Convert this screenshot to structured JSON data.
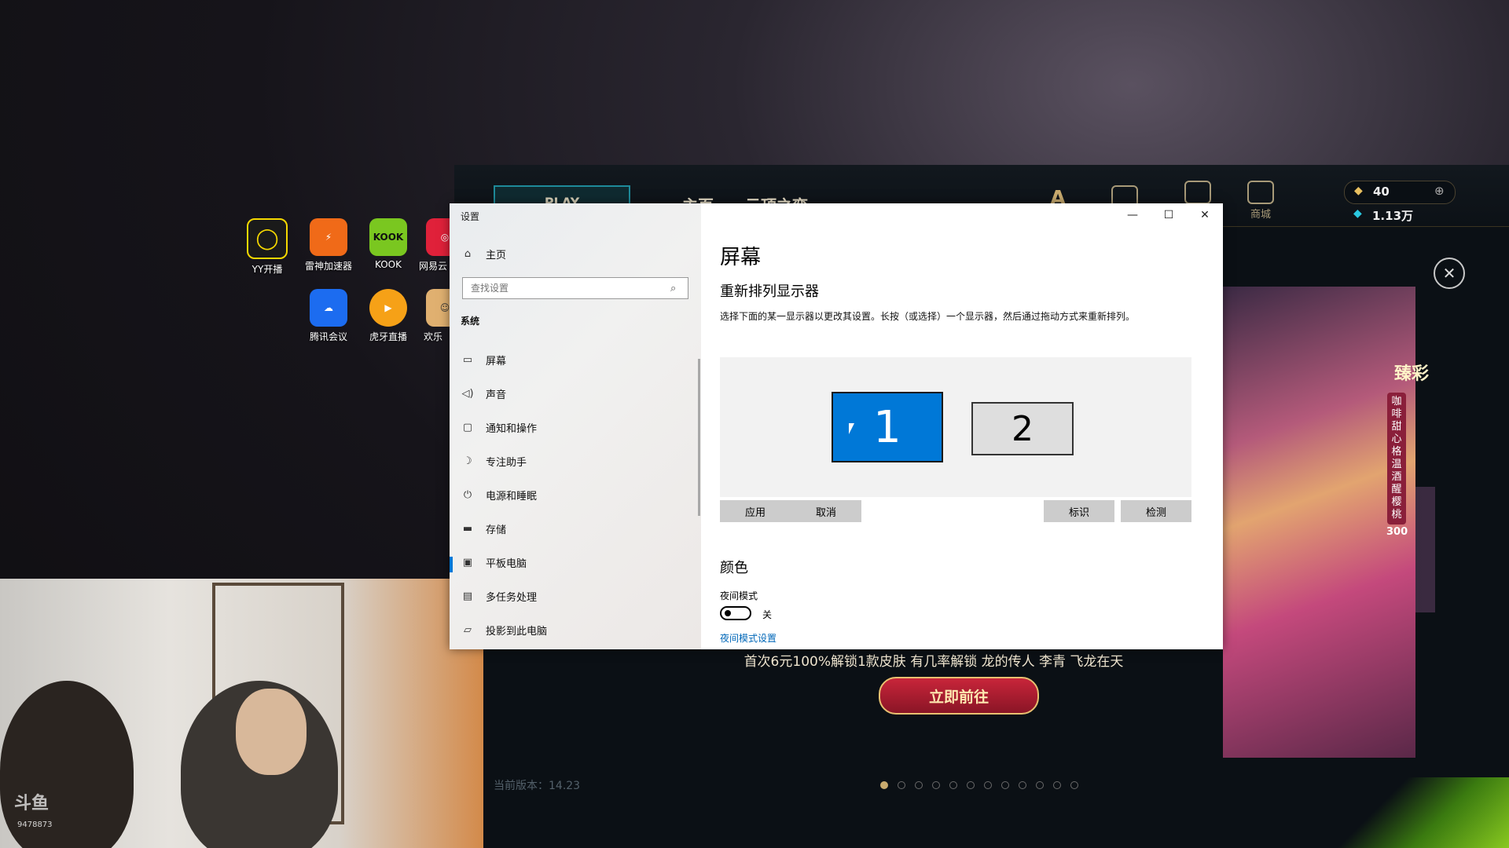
{
  "desktop": {
    "icons": [
      {
        "label": "YY开播",
        "icon": "yy-icon",
        "color": "#1a1a1a"
      },
      {
        "label": "雷神加速器",
        "icon": "leishen-icon",
        "color": "#f06a18"
      },
      {
        "label": "KOOK",
        "icon": "kook-icon",
        "color": "#7ac720"
      },
      {
        "label": "网易云",
        "icon": "netease-icon",
        "color": "#e0213a"
      },
      {
        "label": "腾讯会议",
        "icon": "tencent-meeting-icon",
        "color": "#1c6cf0"
      },
      {
        "label": "虎牙直播",
        "icon": "huya-icon",
        "color": "#f6a117"
      },
      {
        "label": "欢乐",
        "icon": "huanle-icon",
        "color": "#e0b070"
      }
    ]
  },
  "game": {
    "play": "PLAY",
    "nav": [
      "主页",
      "云顶之弈"
    ],
    "buttons": [
      "品",
      "商城"
    ],
    "currency_rp": "40",
    "currency_be": "1.13万",
    "promo_text": "首次6元100%解锁1款皮肤 有几率解锁 龙的传人 李青 飞龙在天",
    "promo_button": "立即前往",
    "version": "当前版本：14.23",
    "splash_title": "臻彩",
    "splash_vertical": "咖啡甜心格温 酒醒樱桃",
    "splash_price": "300"
  },
  "settings": {
    "title": "设置",
    "home": "主页",
    "search_placeholder": "查找设置",
    "section": "系统",
    "nav_items": [
      {
        "label": "屏幕",
        "icon": "display-icon"
      },
      {
        "label": "声音",
        "icon": "sound-icon"
      },
      {
        "label": "通知和操作",
        "icon": "notification-icon"
      },
      {
        "label": "专注助手",
        "icon": "focus-icon"
      },
      {
        "label": "电源和睡眠",
        "icon": "power-icon"
      },
      {
        "label": "存储",
        "icon": "storage-icon"
      },
      {
        "label": "平板电脑",
        "icon": "tablet-icon"
      },
      {
        "label": "多任务处理",
        "icon": "multitask-icon"
      },
      {
        "label": "投影到此电脑",
        "icon": "project-icon"
      }
    ],
    "page_title": "屏幕",
    "rearrange_title": "重新排列显示器",
    "rearrange_desc": "选择下面的某一显示器以更改其设置。长按（或选择）一个显示器，然后通过拖动方式来重新排列。",
    "monitor1": "1",
    "monitor2": "2",
    "apply": "应用",
    "cancel": "取消",
    "identify": "标识",
    "detect": "检测",
    "color_title": "颜色",
    "night_mode": "夜间模式",
    "night_state": "关",
    "night_link": "夜间模式设置",
    "accent": "#0078d7"
  },
  "webcam": {
    "watermark": "斗鱼",
    "room_id": "9478873"
  }
}
